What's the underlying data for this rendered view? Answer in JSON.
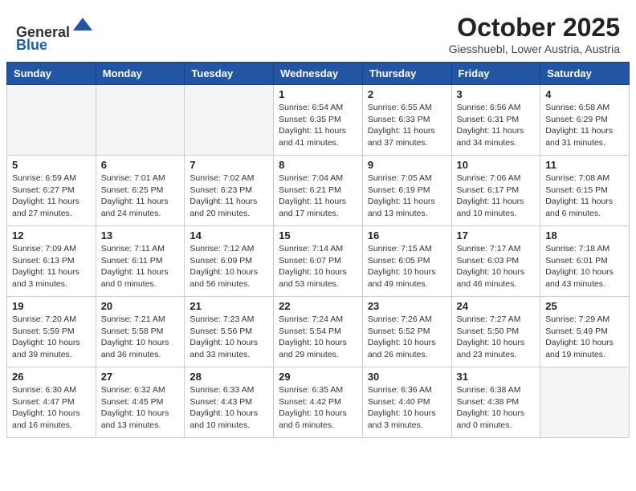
{
  "header": {
    "logo_general": "General",
    "logo_blue": "Blue",
    "month_title": "October 2025",
    "location": "Giesshuebl, Lower Austria, Austria"
  },
  "weekdays": [
    "Sunday",
    "Monday",
    "Tuesday",
    "Wednesday",
    "Thursday",
    "Friday",
    "Saturday"
  ],
  "weeks": [
    [
      {
        "day": "",
        "info": ""
      },
      {
        "day": "",
        "info": ""
      },
      {
        "day": "",
        "info": ""
      },
      {
        "day": "1",
        "info": "Sunrise: 6:54 AM\nSunset: 6:35 PM\nDaylight: 11 hours\nand 41 minutes."
      },
      {
        "day": "2",
        "info": "Sunrise: 6:55 AM\nSunset: 6:33 PM\nDaylight: 11 hours\nand 37 minutes."
      },
      {
        "day": "3",
        "info": "Sunrise: 6:56 AM\nSunset: 6:31 PM\nDaylight: 11 hours\nand 34 minutes."
      },
      {
        "day": "4",
        "info": "Sunrise: 6:58 AM\nSunset: 6:29 PM\nDaylight: 11 hours\nand 31 minutes."
      }
    ],
    [
      {
        "day": "5",
        "info": "Sunrise: 6:59 AM\nSunset: 6:27 PM\nDaylight: 11 hours\nand 27 minutes."
      },
      {
        "day": "6",
        "info": "Sunrise: 7:01 AM\nSunset: 6:25 PM\nDaylight: 11 hours\nand 24 minutes."
      },
      {
        "day": "7",
        "info": "Sunrise: 7:02 AM\nSunset: 6:23 PM\nDaylight: 11 hours\nand 20 minutes."
      },
      {
        "day": "8",
        "info": "Sunrise: 7:04 AM\nSunset: 6:21 PM\nDaylight: 11 hours\nand 17 minutes."
      },
      {
        "day": "9",
        "info": "Sunrise: 7:05 AM\nSunset: 6:19 PM\nDaylight: 11 hours\nand 13 minutes."
      },
      {
        "day": "10",
        "info": "Sunrise: 7:06 AM\nSunset: 6:17 PM\nDaylight: 11 hours\nand 10 minutes."
      },
      {
        "day": "11",
        "info": "Sunrise: 7:08 AM\nSunset: 6:15 PM\nDaylight: 11 hours\nand 6 minutes."
      }
    ],
    [
      {
        "day": "12",
        "info": "Sunrise: 7:09 AM\nSunset: 6:13 PM\nDaylight: 11 hours\nand 3 minutes."
      },
      {
        "day": "13",
        "info": "Sunrise: 7:11 AM\nSunset: 6:11 PM\nDaylight: 11 hours\nand 0 minutes."
      },
      {
        "day": "14",
        "info": "Sunrise: 7:12 AM\nSunset: 6:09 PM\nDaylight: 10 hours\nand 56 minutes."
      },
      {
        "day": "15",
        "info": "Sunrise: 7:14 AM\nSunset: 6:07 PM\nDaylight: 10 hours\nand 53 minutes."
      },
      {
        "day": "16",
        "info": "Sunrise: 7:15 AM\nSunset: 6:05 PM\nDaylight: 10 hours\nand 49 minutes."
      },
      {
        "day": "17",
        "info": "Sunrise: 7:17 AM\nSunset: 6:03 PM\nDaylight: 10 hours\nand 46 minutes."
      },
      {
        "day": "18",
        "info": "Sunrise: 7:18 AM\nSunset: 6:01 PM\nDaylight: 10 hours\nand 43 minutes."
      }
    ],
    [
      {
        "day": "19",
        "info": "Sunrise: 7:20 AM\nSunset: 5:59 PM\nDaylight: 10 hours\nand 39 minutes."
      },
      {
        "day": "20",
        "info": "Sunrise: 7:21 AM\nSunset: 5:58 PM\nDaylight: 10 hours\nand 36 minutes."
      },
      {
        "day": "21",
        "info": "Sunrise: 7:23 AM\nSunset: 5:56 PM\nDaylight: 10 hours\nand 33 minutes."
      },
      {
        "day": "22",
        "info": "Sunrise: 7:24 AM\nSunset: 5:54 PM\nDaylight: 10 hours\nand 29 minutes."
      },
      {
        "day": "23",
        "info": "Sunrise: 7:26 AM\nSunset: 5:52 PM\nDaylight: 10 hours\nand 26 minutes."
      },
      {
        "day": "24",
        "info": "Sunrise: 7:27 AM\nSunset: 5:50 PM\nDaylight: 10 hours\nand 23 minutes."
      },
      {
        "day": "25",
        "info": "Sunrise: 7:29 AM\nSunset: 5:49 PM\nDaylight: 10 hours\nand 19 minutes."
      }
    ],
    [
      {
        "day": "26",
        "info": "Sunrise: 6:30 AM\nSunset: 4:47 PM\nDaylight: 10 hours\nand 16 minutes."
      },
      {
        "day": "27",
        "info": "Sunrise: 6:32 AM\nSunset: 4:45 PM\nDaylight: 10 hours\nand 13 minutes."
      },
      {
        "day": "28",
        "info": "Sunrise: 6:33 AM\nSunset: 4:43 PM\nDaylight: 10 hours\nand 10 minutes."
      },
      {
        "day": "29",
        "info": "Sunrise: 6:35 AM\nSunset: 4:42 PM\nDaylight: 10 hours\nand 6 minutes."
      },
      {
        "day": "30",
        "info": "Sunrise: 6:36 AM\nSunset: 4:40 PM\nDaylight: 10 hours\nand 3 minutes."
      },
      {
        "day": "31",
        "info": "Sunrise: 6:38 AM\nSunset: 4:38 PM\nDaylight: 10 hours\nand 0 minutes."
      },
      {
        "day": "",
        "info": ""
      }
    ]
  ]
}
